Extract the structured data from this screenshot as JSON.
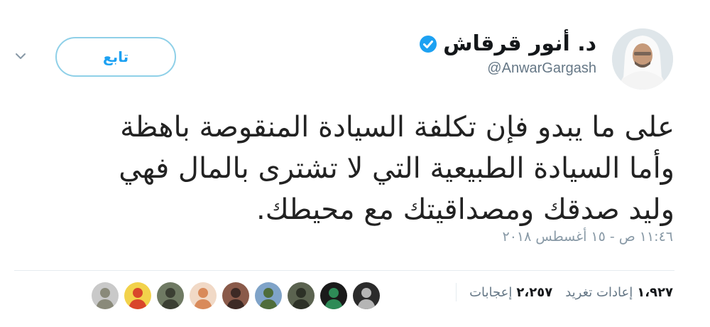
{
  "header": {
    "display_name": "د. أنور قرقاش",
    "handle": "@AnwarGargash",
    "follow_label": "تابع"
  },
  "tweet": {
    "lines": [
      "على ما يبدو فإن تكلفة السيادة المنقوصة باهظة",
      "وأما السيادة الطبيعية التي لا تشترى بالمال فهي",
      "وليد صدقك ومصداقيتك مع محيطك."
    ],
    "timestamp": "١١:٤٦ ص - ١٥ أغسطس ٢٠١٨"
  },
  "stats": {
    "retweets_count": "١،٩٢٧",
    "retweets_label": "إعادات تغريد",
    "likes_count": "٢،٢٥٧",
    "likes_label": "إعجابات"
  },
  "colors": {
    "accent": "#1da1f2",
    "text": "#14171a",
    "muted": "#657786"
  },
  "icons": {
    "verified": "verified-badge-icon",
    "caret": "chevron-down-icon"
  },
  "likers": [
    {
      "name": "liker-avatar-1",
      "bg": "#c9c9c9",
      "fg": "#8a8a7a"
    },
    {
      "name": "liker-avatar-2",
      "bg": "#f2d24b",
      "fg": "#d9462b"
    },
    {
      "name": "liker-avatar-3",
      "bg": "#6f7a63",
      "fg": "#3b3f33"
    },
    {
      "name": "liker-avatar-4",
      "bg": "#f1d9c6",
      "fg": "#d98a5a"
    },
    {
      "name": "liker-avatar-5",
      "bg": "#8a5a4a",
      "fg": "#3d2a25"
    },
    {
      "name": "liker-avatar-6",
      "bg": "#7fa3c8",
      "fg": "#4f6d3a"
    },
    {
      "name": "liker-avatar-7",
      "bg": "#5b6350",
      "fg": "#2d3127"
    },
    {
      "name": "liker-avatar-8",
      "bg": "#1a1a1a",
      "fg": "#2e8b57"
    },
    {
      "name": "liker-avatar-9",
      "bg": "#2b2b2b",
      "fg": "#b5b5b5"
    }
  ]
}
